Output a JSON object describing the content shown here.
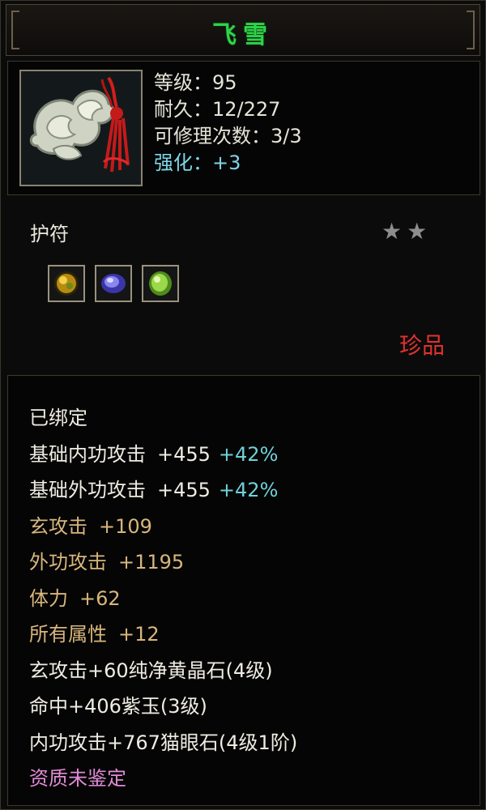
{
  "item": {
    "name": "飞雪",
    "icon": "jade-cloud-amulet-icon",
    "stats": {
      "level": "等级：95",
      "durability": "耐久：12/227",
      "repairs": "可修理次数：3/3",
      "enhance": "强化：+3"
    },
    "type": "护符",
    "stars": "★★",
    "gems": [
      {
        "icon": "yellow-crystal-gem-icon",
        "color": "#c99a1a"
      },
      {
        "icon": "purple-jade-gem-icon",
        "color": "#5a56d8"
      },
      {
        "icon": "cat-eye-gem-icon",
        "color": "#7fc23a"
      }
    ],
    "rarity": "珍品"
  },
  "attributes": {
    "bound": "已绑定",
    "base_inner": {
      "label": "基础内功攻击",
      "value": "+455",
      "pct": "+42%"
    },
    "base_outer": {
      "label": "基础外功攻击",
      "value": "+455",
      "pct": "+42%"
    },
    "xuan": {
      "label": "玄攻击",
      "value": "+109"
    },
    "outer": {
      "label": "外功攻击",
      "value": "+1195"
    },
    "stamina": {
      "label": "体力",
      "value": "+62"
    },
    "all_attr": {
      "label": "所有属性",
      "value": "+12"
    },
    "gem_lines": [
      "玄攻击+60纯净黄晶石(4级)",
      "命中+406紫玉(3级)",
      "内功攻击+767猫眼石(4级1阶)"
    ],
    "quality": "资质未鉴定"
  },
  "colors": {
    "title": "#2fd24a",
    "enhance": "#7fd6e8",
    "rarity": "#e0322e",
    "gold": "#d8b67c",
    "quality": "#e18bd6"
  }
}
